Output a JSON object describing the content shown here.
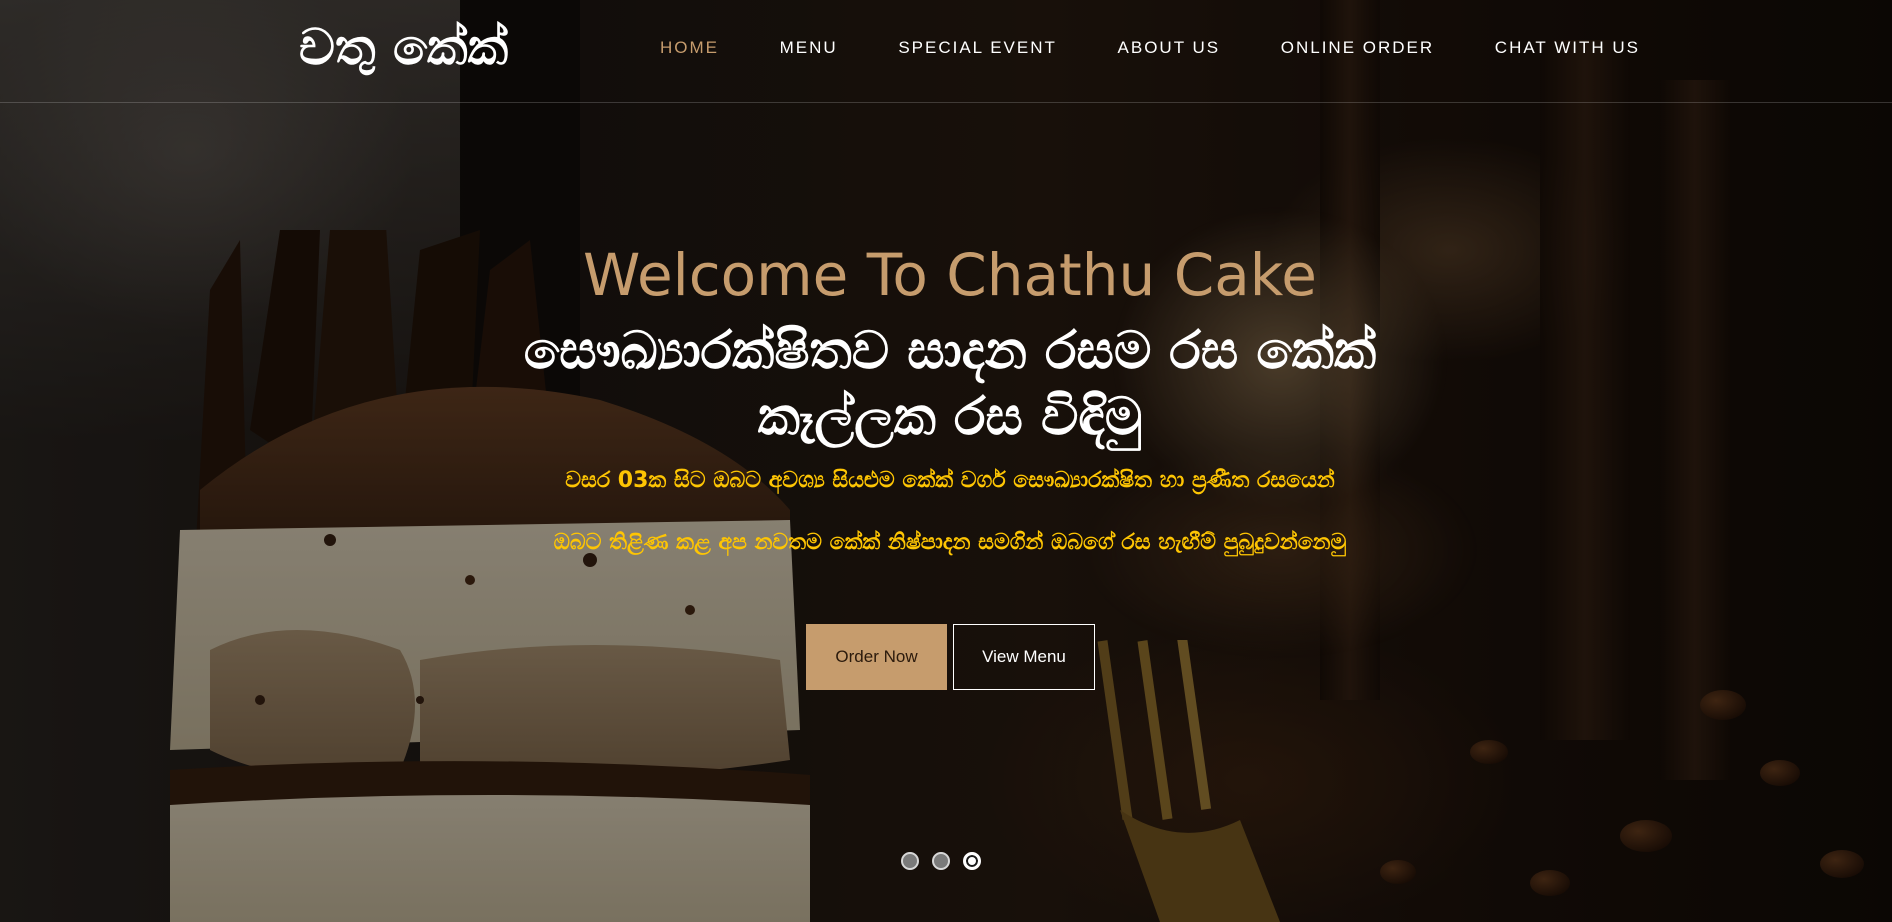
{
  "header": {
    "logo_text": "චතු කේක්",
    "nav": [
      {
        "label": "HOME",
        "active": true
      },
      {
        "label": "MENU",
        "active": false
      },
      {
        "label": "SPECIAL EVENT",
        "active": false
      },
      {
        "label": "ABOUT US",
        "active": false
      },
      {
        "label": "ONLINE ORDER",
        "active": false
      },
      {
        "label": "CHAT WITH US",
        "active": false
      }
    ]
  },
  "hero": {
    "welcome": "Welcome To Chathu Cake",
    "heading": "සෞඛ්‍යාරක්ෂිතව සාදන රසම රස කේක් කෑල්ලක රස විඳිමු",
    "subtext_line1": "වසර 03ක සිට ඔබට අවශ්‍ය සියළුම කේක් වර්ග සෞඛ්‍යාරක්ෂිත හා ප්‍රණීත රසයෙන්",
    "subtext_line2": "ඔබට තිළිණ කළ අප නවතම කේක් නිෂ්පාදන සමගින් ඔබගේ රස හැඟීම් පුබුදුවන්නෙමු",
    "buttons": {
      "order": "Order Now",
      "menu": "View Menu"
    },
    "background_image": "chocolate-tiramisu-cake-slice"
  },
  "carousel": {
    "slide_count": 3,
    "active_index": 2
  },
  "colors": {
    "accent": "#c69c6d",
    "subtext": "#fec503",
    "nav_text": "#ffffff"
  }
}
